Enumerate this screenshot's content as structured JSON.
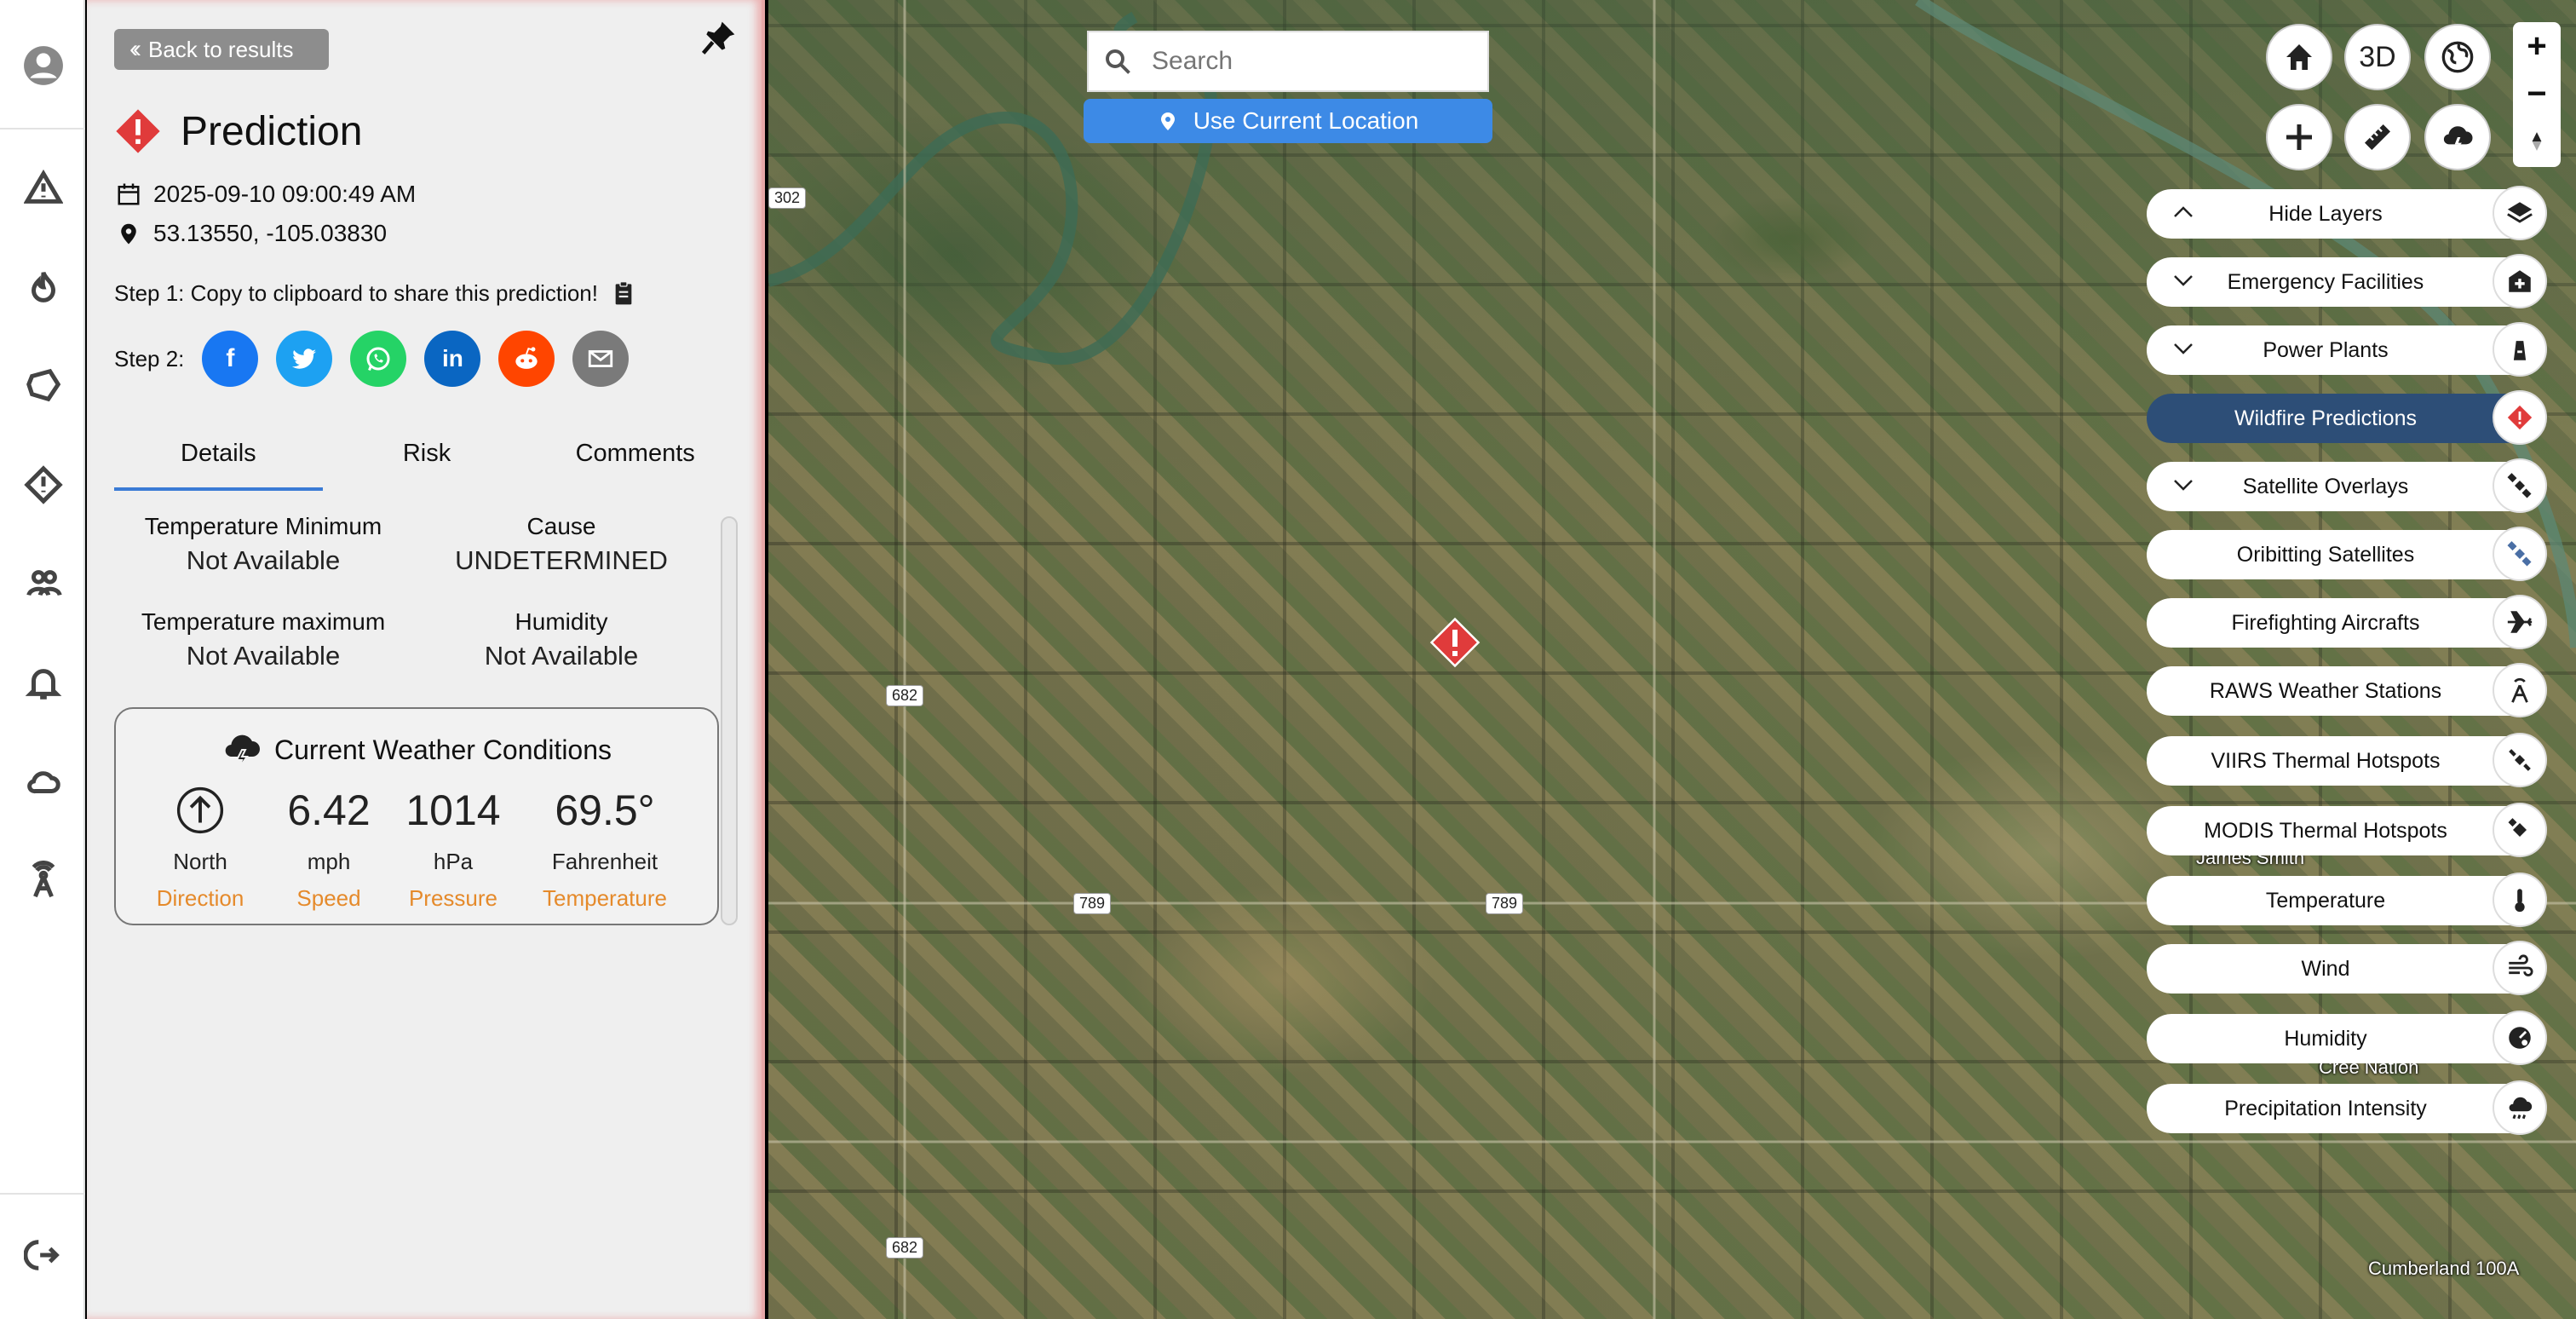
{
  "panel": {
    "back_label": "Back to results",
    "title": "Prediction",
    "datetime": "2025-09-10 09:00:49 AM",
    "coords": "53.13550, -105.03830",
    "step1": "Step 1: Copy to clipboard to share this prediction!",
    "step2": "Step 2:",
    "tabs": [
      "Details",
      "Risk",
      "Comments"
    ],
    "details": [
      {
        "k": "Temperature Minimum",
        "v": "Not Available"
      },
      {
        "k": "Cause",
        "v": "UNDETERMINED"
      },
      {
        "k": "Temperature maximum",
        "v": "Not Available"
      },
      {
        "k": "Humidity",
        "v": "Not Available"
      }
    ],
    "weather": {
      "title": "Current Weather Conditions",
      "direction": {
        "unit": "North",
        "label": "Direction"
      },
      "speed": {
        "value": "6.42",
        "unit": "mph",
        "label": "Speed"
      },
      "pressure": {
        "value": "1014",
        "unit": "hPa",
        "label": "Pressure"
      },
      "temperature": {
        "value": "69.5°",
        "unit": "Fahrenheit",
        "label": "Temperature"
      }
    }
  },
  "share_icons": [
    "facebook-icon",
    "twitter-icon",
    "whatsapp-icon",
    "linkedin-icon",
    "reddit-icon",
    "email-icon"
  ],
  "map": {
    "search_placeholder": "Search",
    "use_location": "Use Current Location",
    "view_3d": "3D",
    "road_labels": [
      "302",
      "682",
      "789",
      "789",
      "682"
    ],
    "places": [
      "James Smith",
      "Cree Nation",
      "Cumberland 100A"
    ]
  },
  "layers": [
    "Hide Layers",
    "Emergency Facilities",
    "Power Plants",
    "Wildfire Predictions",
    "Satellite Overlays",
    "Oribitting Satellites",
    "Firefighting Aircrafts",
    "RAWS Weather Stations",
    "VIIRS Thermal Hotspots",
    "MODIS Thermal Hotspots",
    "Temperature",
    "Wind",
    "Humidity",
    "Precipitation Intensity"
  ],
  "colors": {
    "accent": "#3d8ae6",
    "active_layer": "#2d4e77",
    "alert": "#e03b3b",
    "label_orange": "#e58a2b"
  }
}
